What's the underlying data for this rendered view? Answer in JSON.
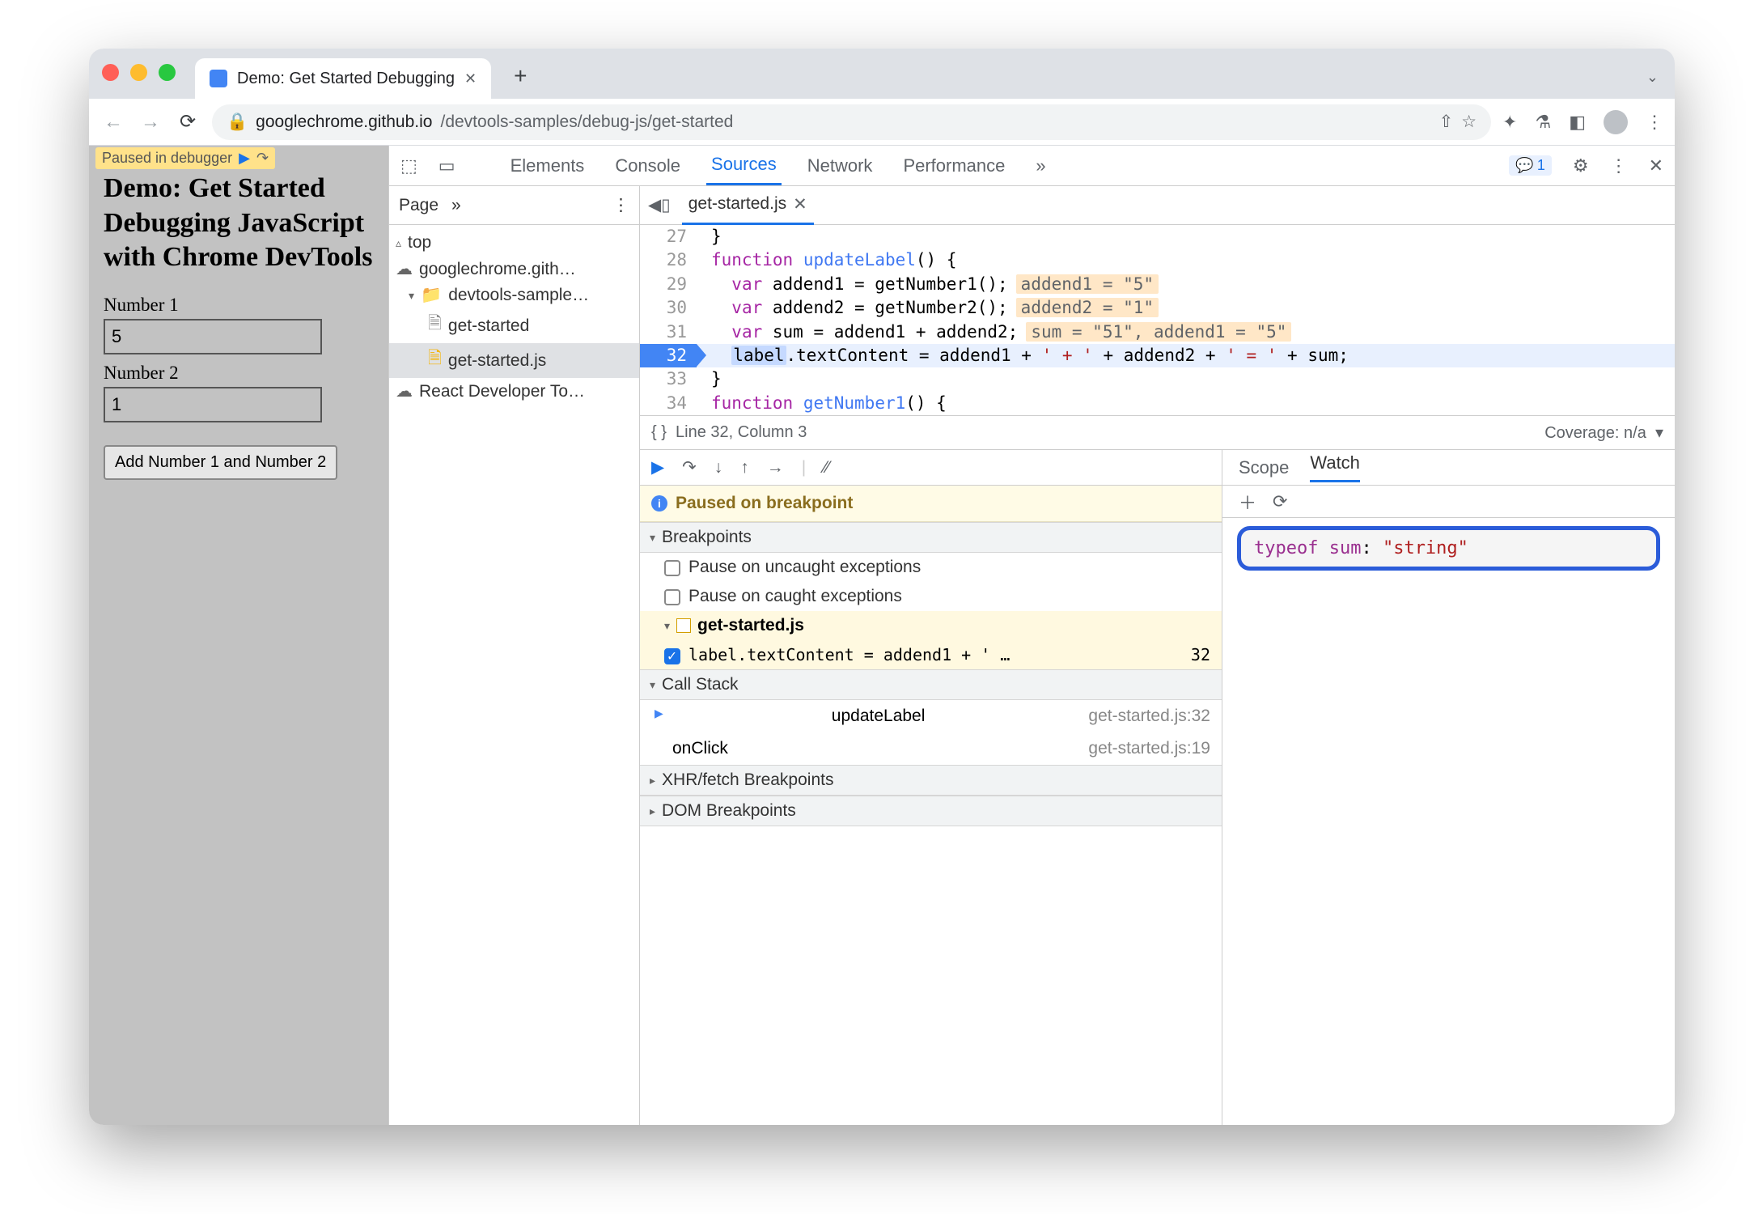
{
  "browser": {
    "tab_title": "Demo: Get Started Debugging",
    "url_host": "googlechrome.github.io",
    "url_path": "/devtools-samples/debug-js/get-started",
    "new_tab": "+"
  },
  "paused_overlay": "Paused in debugger",
  "page": {
    "heading": "Demo: Get Started Debugging JavaScript with Chrome DevTools",
    "label1": "Number 1",
    "value1": "5",
    "label2": "Number 2",
    "value2": "1",
    "button": "Add Number 1 and Number 2"
  },
  "devtools": {
    "panels": [
      "Elements",
      "Console",
      "Sources",
      "Network",
      "Performance"
    ],
    "more": "»",
    "issues_count": "1",
    "navigator": {
      "tab": "Page",
      "more": "»",
      "items": {
        "top": "top",
        "domain": "googlechrome.gith…",
        "folder": "devtools-sample…",
        "file_html": "get-started",
        "file_js": "get-started.js",
        "ext": "React Developer To…"
      }
    },
    "editor": {
      "tab": "get-started.js",
      "lines": [
        {
          "n": "27",
          "indent": "",
          "code": "}"
        },
        {
          "n": "28",
          "indent": "",
          "kw": "function",
          "fn": "updateLabel",
          "rest": "() {"
        },
        {
          "n": "29",
          "indent": "  ",
          "kw": "var",
          "rest": " addend1 = getNumber1();",
          "inline": "addend1 = \"5\""
        },
        {
          "n": "30",
          "indent": "  ",
          "kw": "var",
          "rest": " addend2 = getNumber2();",
          "inline": "addend2 = \"1\""
        },
        {
          "n": "31",
          "indent": "  ",
          "kw": "var",
          "rest": " sum = addend1 + addend2;",
          "inline": "sum = \"51\", addend1 = \"5\""
        },
        {
          "n": "32",
          "indent": "  ",
          "hl": true,
          "varhl": "label",
          "rest": ".textContent = addend1 + ",
          "s1": "' + '",
          "mid": " + addend2 + ",
          "s2": "' = '",
          "end": " + sum;"
        },
        {
          "n": "33",
          "indent": "",
          "code": "}"
        },
        {
          "n": "34",
          "indent": "",
          "kw": "function",
          "fn": "getNumber1",
          "rest": "() {"
        }
      ],
      "status_left": "Line 32, Column 3",
      "status_right": "Coverage: n/a"
    },
    "debugger": {
      "paused_msg": "Paused on breakpoint",
      "sections": {
        "breakpoints": "Breakpoints",
        "uncaught": "Pause on uncaught exceptions",
        "caught": "Pause on caught exceptions",
        "bp_file": "get-started.js",
        "bp_code": "label.textContent = addend1 + ' …",
        "bp_line": "32",
        "callstack": "Call Stack",
        "frames": [
          {
            "name": "updateLabel",
            "loc": "get-started.js:32"
          },
          {
            "name": "onClick",
            "loc": "get-started.js:19"
          }
        ],
        "xhr": "XHR/fetch Breakpoints",
        "dom": "DOM Breakpoints"
      },
      "scope_tabs": {
        "scope": "Scope",
        "watch": "Watch"
      },
      "watch": {
        "expr": "typeof sum",
        "val": "\"string\""
      }
    }
  }
}
